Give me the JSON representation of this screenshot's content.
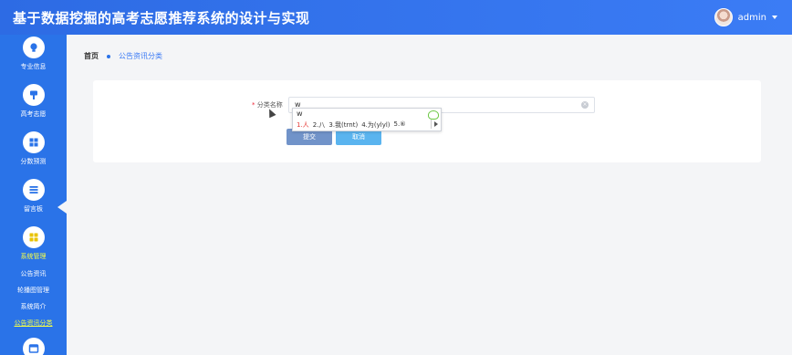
{
  "header": {
    "title": "基于数据挖掘的高考志愿推荐系统的设计与实现",
    "username": "admin"
  },
  "sidebar": {
    "items": [
      {
        "label": "专业信息",
        "icon": "bulb-icon"
      },
      {
        "label": "高考志愿",
        "icon": "brush-icon"
      },
      {
        "label": "分数预测",
        "icon": "grid-icon"
      },
      {
        "label": "留言板",
        "icon": "list-icon"
      },
      {
        "label": "系统管理",
        "icon": "apps-icon",
        "active": true
      }
    ],
    "sub_items": [
      {
        "label": "公告资讯"
      },
      {
        "label": "轮播图管理"
      },
      {
        "label": "系统简介"
      },
      {
        "label": "公告资讯分类",
        "active": true
      }
    ]
  },
  "breadcrumb": {
    "home": "首页",
    "current": "公告资讯分类"
  },
  "form": {
    "required_mark": "*",
    "label": "分类名称",
    "value": "w",
    "submit_label": "提交",
    "cancel_label": "取消"
  },
  "ime": {
    "composition": "w",
    "candidates": [
      "1.人",
      "2.八",
      "3.我(trnt)",
      "4.为(ylyl)",
      "5.⑥"
    ]
  },
  "colors": {
    "header": "#2d6be4",
    "sidebar": "#2a73e8",
    "active_text": "#f7ff45",
    "submit": "#7193c9",
    "cancel": "#5ab4ef"
  }
}
